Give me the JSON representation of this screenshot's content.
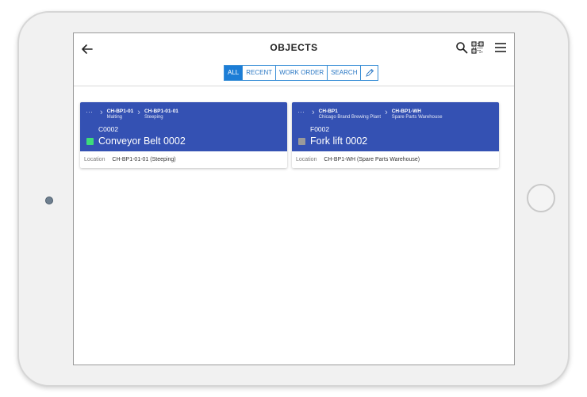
{
  "header": {
    "title": "OBJECTS"
  },
  "tabs": [
    {
      "label": "ALL",
      "active": true
    },
    {
      "label": "RECENT",
      "active": false
    },
    {
      "label": "WORK ORDER",
      "active": false
    },
    {
      "label": "SEARCH",
      "active": false
    }
  ],
  "icons": {
    "back": "arrow-left-icon",
    "search": "search-icon",
    "qr": "qr-code-icon",
    "menu": "hamburger-menu-icon",
    "tab_extra": "pencil-icon"
  },
  "cards": [
    {
      "ellipsis": "···",
      "breadcrumbs": [
        {
          "code": "CH-BP1-01",
          "name": "Malting"
        },
        {
          "code": "CH-BP1-01-01",
          "name": "Steeping"
        }
      ],
      "code": "C0002",
      "name": "Conveyor Belt 0002",
      "status_color": "#3ddc7a",
      "location_label": "Location",
      "location_value": "CH-BP1-01-01 (Steeping)"
    },
    {
      "ellipsis": "···",
      "breadcrumbs": [
        {
          "code": "CH-BP1",
          "name": "Chicago Brand Brewing Plant"
        },
        {
          "code": "CH-BP1-WH",
          "name": "Spare Parts Warehouse"
        }
      ],
      "code": "F0002",
      "name": "Fork lift 0002",
      "status_color": "#9a9a9a",
      "location_label": "Location",
      "location_value": "CH-BP1-WH (Spare Parts Warehouse)"
    }
  ],
  "colors": {
    "card_header": "#3451b3",
    "tab_active": "#1c7dd6",
    "tab_border": "#3a8fd6"
  }
}
